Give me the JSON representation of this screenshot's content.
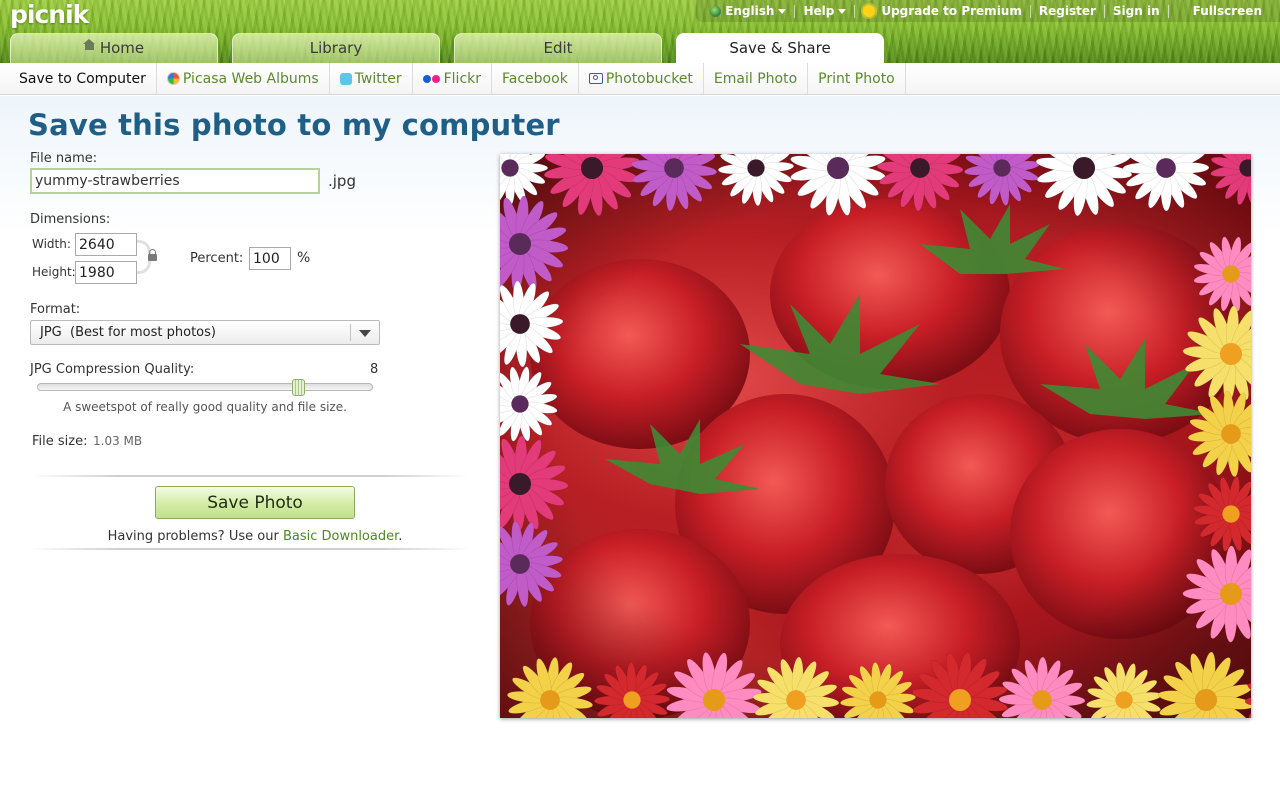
{
  "brand": {
    "logo_text": "picnik"
  },
  "topbar": {
    "language": "English",
    "help": "Help",
    "upgrade": "Upgrade to Premium",
    "register": "Register",
    "sign_in": "Sign in",
    "fullscreen": "Fullscreen"
  },
  "tabs": [
    {
      "label": "Home"
    },
    {
      "label": "Library"
    },
    {
      "label": "Edit"
    },
    {
      "label": "Save & Share"
    }
  ],
  "active_tab": "Save & Share",
  "subnav": [
    {
      "label": "Save to Computer"
    },
    {
      "label": "Picasa Web Albums"
    },
    {
      "label": "Twitter"
    },
    {
      "label": "Flickr"
    },
    {
      "label": "Facebook"
    },
    {
      "label": "Photobucket"
    },
    {
      "label": "Email Photo"
    },
    {
      "label": "Print Photo"
    }
  ],
  "active_subnav": "Save to Computer",
  "form": {
    "title": "Save this photo to my computer",
    "file_name_label": "File name:",
    "file_name_value": "yummy-strawberries",
    "extension": ".jpg",
    "dimensions_label": "Dimensions:",
    "width_label": "Width:",
    "width_value": "2640",
    "height_label": "Height:",
    "height_value": "1980",
    "percent_label": "Percent:",
    "percent_value": "100",
    "percent_unit": "%",
    "format_label": "Format:",
    "format_value": "JPG  (Best for most photos)",
    "quality_label": "JPG Compression Quality:",
    "quality_value": "8",
    "quality_hint": "A sweetspot of really good quality and file size.",
    "file_size_label": "File size:",
    "file_size_value": "1.03 MB",
    "save_button": "Save Photo",
    "problems_text": "Having problems? Use our ",
    "problems_link": "Basic Downloader",
    "problems_end": "."
  },
  "photo": {
    "subject": "strawberries with daisy flower frame"
  },
  "colors": {
    "title": "#1f5f86",
    "link_green": "#5b8a2e",
    "header_grass": "#86bf2c",
    "button_green": "#d4eca6"
  }
}
